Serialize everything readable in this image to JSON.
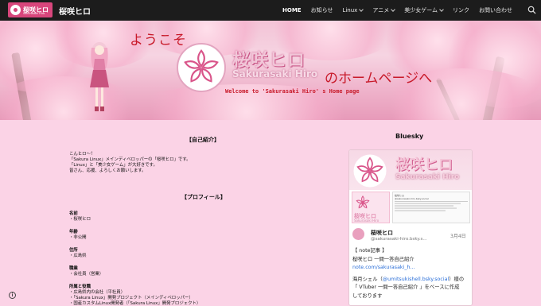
{
  "header": {
    "logo_text": "桜咲ヒロ",
    "logo_sub": "Sakurasaki Hiro",
    "site_title": "桜咲ヒロ",
    "nav": [
      {
        "label": "HOME",
        "active": true,
        "dropdown": false
      },
      {
        "label": "お知らせ",
        "active": false,
        "dropdown": false
      },
      {
        "label": "Linux",
        "active": false,
        "dropdown": true
      },
      {
        "label": "アニメ",
        "active": false,
        "dropdown": true
      },
      {
        "label": "美少女ゲーム",
        "active": false,
        "dropdown": true
      },
      {
        "label": "リンク",
        "active": false,
        "dropdown": false
      },
      {
        "label": "お問い合わせ",
        "active": false,
        "dropdown": false
      }
    ],
    "search_icon": "search-icon"
  },
  "banner": {
    "welcome": "ようこそ",
    "brand_jp": "桜咲ヒロ",
    "brand_en": "Sakurasaki Hiro",
    "homepage": "のホームページへ",
    "welcome_en": "Welcome to 'Sakurasaki Hiro' s Home page"
  },
  "intro": {
    "heading": "【自己紹介】",
    "lines": "こんヒロ〜！\n「Sakura Linux」メインディベロッパーの「桜咲ヒロ」です。\n「Linux」と「美少女ゲーム」が大好きです。\n皆さん、応援、よろしくお願いします。"
  },
  "profile": {
    "heading": "【プロフィール】",
    "items": [
      {
        "label": "名前",
        "value": "・桜咲ヒロ"
      },
      {
        "label": "年齢",
        "value": "・非公開"
      },
      {
        "label": "住所",
        "value": "・広島県"
      },
      {
        "label": "職業",
        "value": "・会社員（営業）"
      },
      {
        "label": "所属と役職",
        "value": "・広島県内の会社（平社員）\n・「Sakura Linux」開発プロジェクト（メインディベロッパー）\n・国産カスタムLinux開発者（「Sakura Linux」開発プロジェクト）"
      }
    ]
  },
  "bluesky": {
    "title": "Bluesky",
    "brand_jp": "桜咲ヒロ",
    "brand_en": "Sakurasaki Hiro",
    "mini_brand_jp": "桜咲ヒロ",
    "mini_brand_en": "Sakurasaki Hiro",
    "doc_heading": "桜咲ヒロ",
    "doc_sub": "@sakurasaki-hiro.bsky.social",
    "name": "桜咲ヒロ",
    "handle": "@sakurasaki-hiro.bsky.s...",
    "date": "3月4日",
    "post_line1": "【 note記事 】",
    "post_line2": "桜咲ヒロ 一問一答自己紹介",
    "post_link": "note.com/sakurasaki_h...",
    "post_line3a": "海月シェル（",
    "post_mention": "@umitsukishell.bsky.social",
    "post_line3b": "）様の",
    "post_line4": "「 VTuber 一問一答自己紹介 」をベースに作成",
    "post_line5": "しております"
  },
  "colors": {
    "accent": "#d8467c",
    "banner_red": "#c81a2a",
    "page_bg": "#fbd3e6",
    "nav_bg": "#1c1c1c"
  },
  "info_icon": "info-icon"
}
